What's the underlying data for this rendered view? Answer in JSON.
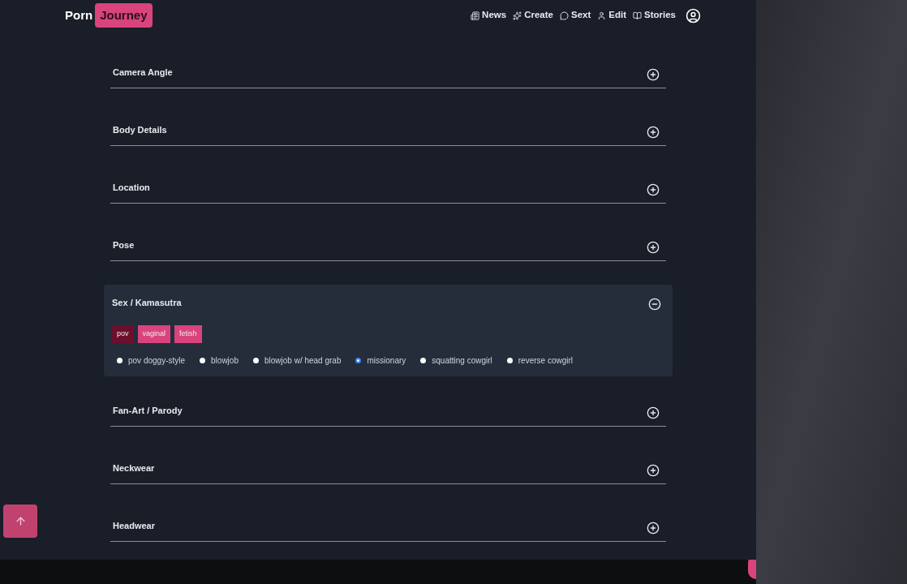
{
  "header": {
    "logo": {
      "first": "Porn",
      "second": "Journey"
    },
    "nav": [
      {
        "label": "News",
        "kind": "news"
      },
      {
        "label": "Create",
        "kind": "sparkles"
      },
      {
        "label": "Sext",
        "kind": "chat"
      },
      {
        "label": "Edit",
        "kind": "person"
      },
      {
        "label": "Stories",
        "kind": "book"
      }
    ]
  },
  "sections": [
    {
      "title": "Camera Angle",
      "expanded": false
    },
    {
      "title": "Body Details",
      "expanded": false
    },
    {
      "title": "Location",
      "expanded": false
    },
    {
      "title": "Pose",
      "expanded": false
    },
    {
      "title": "Sex / Kamasutra",
      "expanded": true,
      "tags": [
        {
          "label": "pov",
          "selected": true
        },
        {
          "label": "vaginal",
          "selected": false
        },
        {
          "label": "fetish",
          "selected": false
        }
      ],
      "options": [
        {
          "label": "pov doggy-style",
          "selected": false
        },
        {
          "label": "blowjob",
          "selected": false
        },
        {
          "label": "blowjob w/ head grab",
          "selected": false
        },
        {
          "label": "missionary",
          "selected": true
        },
        {
          "label": "squatting cowgirl",
          "selected": false
        },
        {
          "label": "reverse cowgirl",
          "selected": false
        }
      ]
    },
    {
      "title": "Fan-Art / Parody",
      "expanded": false
    },
    {
      "title": "Neckwear",
      "expanded": false
    },
    {
      "title": "Headwear",
      "expanded": false
    }
  ]
}
